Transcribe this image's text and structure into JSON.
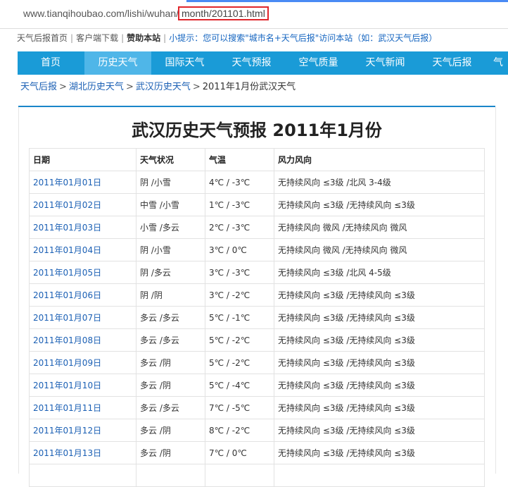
{
  "address_bar": {
    "url_prefix": "www.tianqihoubao.com/lishi/wuhan/",
    "url_highlight": "month/201101.html"
  },
  "top_links": {
    "home": "天气后报首页",
    "client": "客户端下载",
    "sponsor": "赞助本站",
    "tip": "小提示：您可以搜索\"城市名+天气后报\"访问本站（如：武汉天气后报）"
  },
  "nav": {
    "items": [
      "首页",
      "历史天气",
      "国际天气",
      "天气预报",
      "空气质量",
      "天气新闻",
      "天气后报",
      "气"
    ],
    "active_index": 1
  },
  "breadcrumb": {
    "level1": "天气后报",
    "level2": "湖北历史天气",
    "level3": "武汉历史天气",
    "current": "2011年1月份武汉天气"
  },
  "page_title": "武汉历史天气预报 2011年1月份",
  "table": {
    "headers": [
      "日期",
      "天气状况",
      "气温",
      "风力风向"
    ],
    "rows": [
      [
        "2011年01月01日",
        "阴 /小雪",
        "4℃ / -3℃",
        "无持续风向 ≤3级 /北风 3-4级"
      ],
      [
        "2011年01月02日",
        "中雪 /小雪",
        "1℃ / -3℃",
        "无持续风向 ≤3级 /无持续风向 ≤3级"
      ],
      [
        "2011年01月03日",
        "小雪 /多云",
        "2℃ / -3℃",
        "无持续风向 微风 /无持续风向 微风"
      ],
      [
        "2011年01月04日",
        "阴 /小雪",
        "3℃ / 0℃",
        "无持续风向 微风 /无持续风向 微风"
      ],
      [
        "2011年01月05日",
        "阴 /多云",
        "3℃ / -3℃",
        "无持续风向 ≤3级 /北风 4-5级"
      ],
      [
        "2011年01月06日",
        "阴 /阴",
        "3℃ / -2℃",
        "无持续风向 ≤3级 /无持续风向 ≤3级"
      ],
      [
        "2011年01月07日",
        "多云 /多云",
        "5℃ / -1℃",
        "无持续风向 ≤3级 /无持续风向 ≤3级"
      ],
      [
        "2011年01月08日",
        "多云 /多云",
        "5℃ / -2℃",
        "无持续风向 ≤3级 /无持续风向 ≤3级"
      ],
      [
        "2011年01月09日",
        "多云 /阴",
        "5℃ / -2℃",
        "无持续风向 ≤3级 /无持续风向 ≤3级"
      ],
      [
        "2011年01月10日",
        "多云 /阴",
        "5℃ / -4℃",
        "无持续风向 ≤3级 /无持续风向 ≤3级"
      ],
      [
        "2011年01月11日",
        "多云 /多云",
        "7℃ / -5℃",
        "无持续风向 ≤3级 /无持续风向 ≤3级"
      ],
      [
        "2011年01月12日",
        "多云 /阴",
        "8℃ / -2℃",
        "无持续风向 ≤3级 /无持续风向 ≤3级"
      ],
      [
        "2011年01月13日",
        "多云 /阴",
        "7℃ / 0℃",
        "无持续风向 ≤3级 /无持续风向 ≤3级"
      ],
      [
        "",
        "",
        "",
        ""
      ]
    ]
  },
  "colors": {
    "nav_bg": "#1a9bd7",
    "nav_active": "#4fb6e8",
    "link": "#1a5fb4",
    "highlight_border": "#e0252b"
  }
}
